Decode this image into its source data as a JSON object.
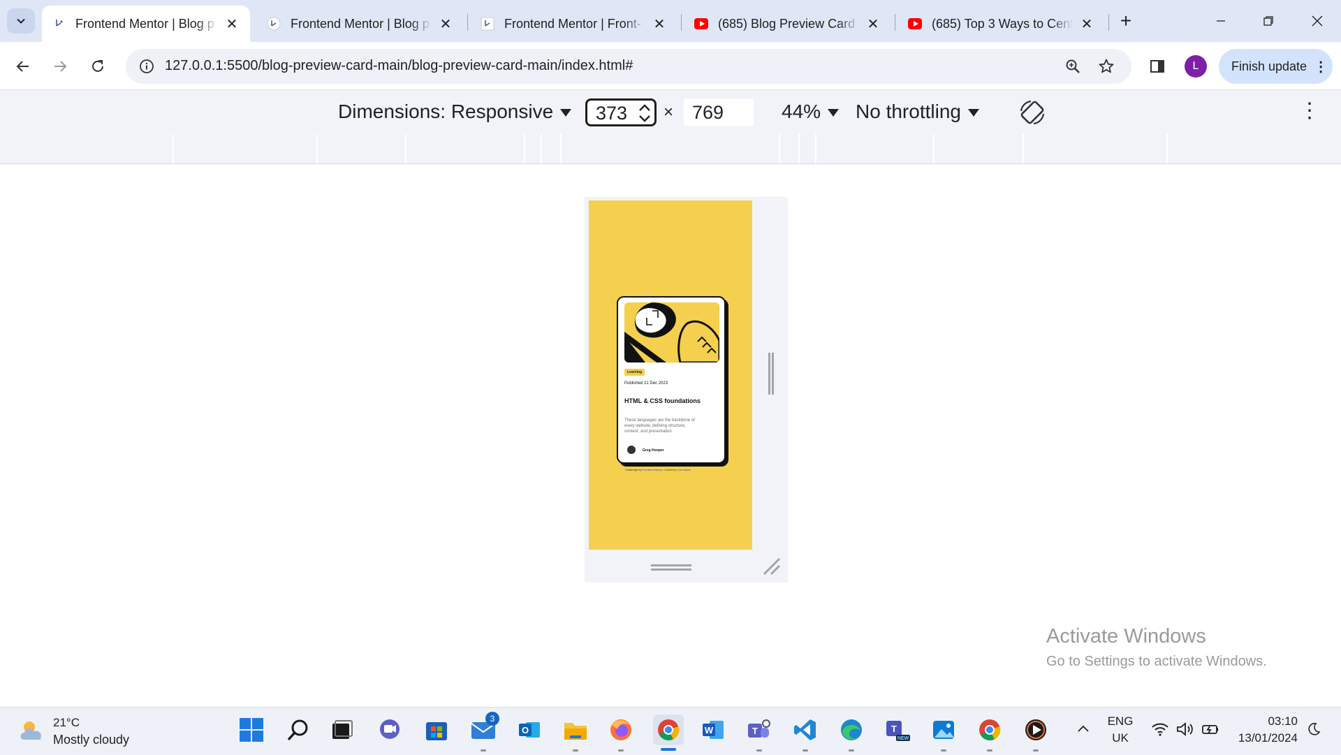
{
  "tabs": [
    {
      "title": "Frontend Mentor | Blog p",
      "favicon": "frontend-mentor",
      "active": true
    },
    {
      "title": "Frontend Mentor | Blog p",
      "favicon": "frontend-mentor",
      "active": false
    },
    {
      "title": "Frontend Mentor | Front-",
      "favicon": "frontend-mentor",
      "active": false
    },
    {
      "title": "(685) Blog Preview Card |",
      "favicon": "youtube",
      "active": false
    },
    {
      "title": "(685) Top 3 Ways to Cent",
      "favicon": "youtube",
      "active": false
    }
  ],
  "toolbar": {
    "url": "127.0.0.1:5500/blog-preview-card-main/blog-preview-card-main/index.html#",
    "profile_initial": "L",
    "update_label": "Finish update"
  },
  "device_toolbar": {
    "dimensions_label": "Dimensions: Responsive",
    "width": "373",
    "times": "×",
    "height": "769",
    "zoom": "44%",
    "throttling": "No throttling"
  },
  "card": {
    "tag": "Learning",
    "published": "Published 21 Dec 2023",
    "title": "HTML & CSS foundations",
    "description": "These languages are the backbone of every website, defining structure, content, and presentation.",
    "author": "Greg Hooper"
  },
  "attribution": {
    "prefix": "Challenge by",
    "link1": "Frontend Mentor",
    "middle": ". Coded by",
    "link2": "Your Name"
  },
  "watermark": {
    "title": "Activate Windows",
    "subtitle": "Go to Settings to activate Windows."
  },
  "taskbar": {
    "weather_temp": "21°C",
    "weather_desc": "Mostly cloudy",
    "mail_badge": "3",
    "lang_top": "ENG",
    "lang_bottom": "UK",
    "time": "03:10",
    "date": "13/01/2024"
  },
  "colors": {
    "page_bg": "#f4d04e",
    "card_border": "#111111",
    "accent_blue": "#1a73e8",
    "profile": "#7e1fa8"
  }
}
